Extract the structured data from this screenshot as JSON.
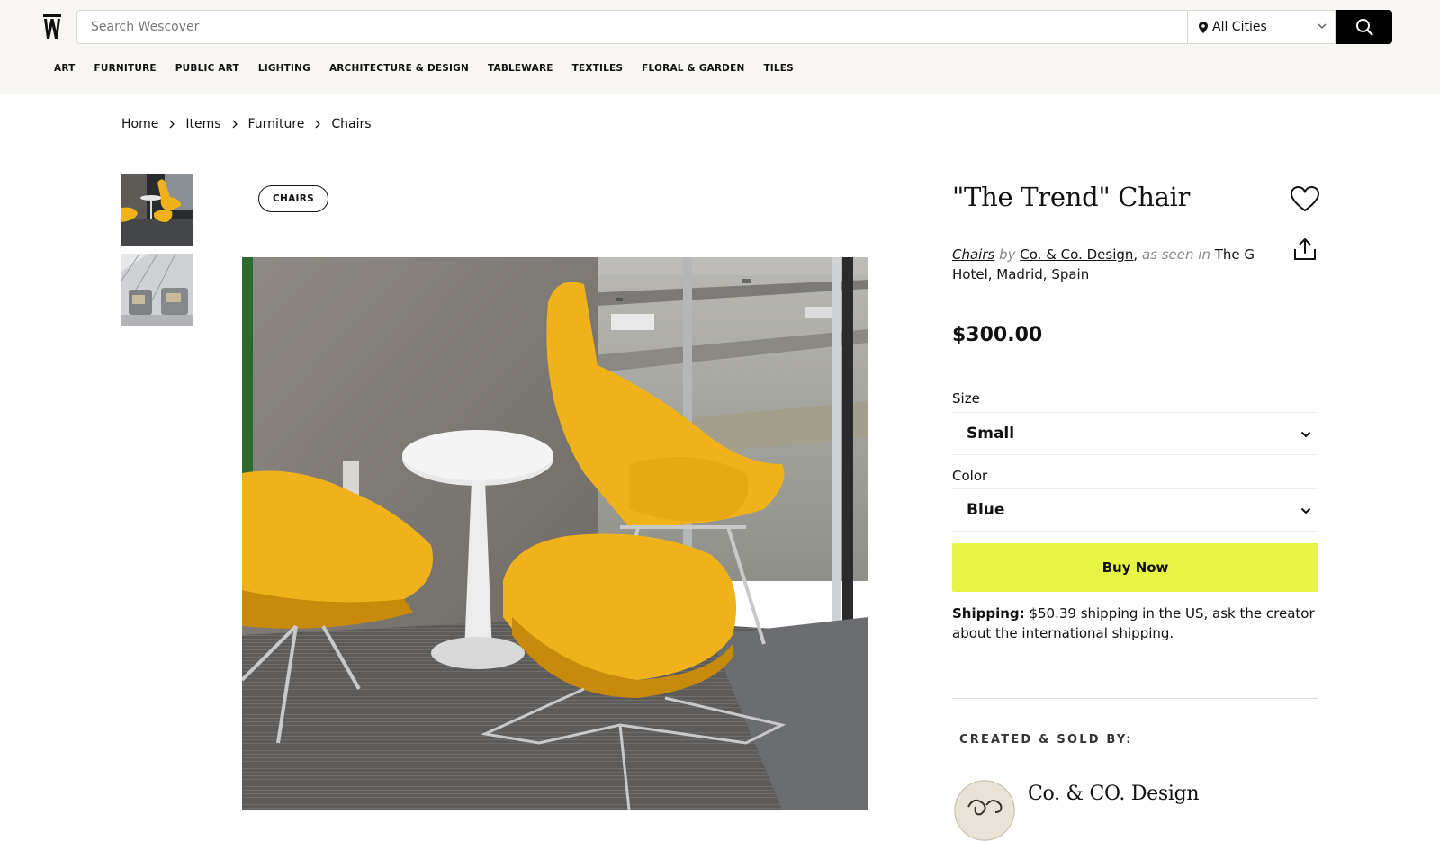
{
  "header": {
    "logo_alt": "W",
    "search": {
      "placeholder": "Search Wescover",
      "value": ""
    },
    "city_select": {
      "value": "All Cities",
      "icon": "map-pin-icon"
    },
    "search_button_icon": "search-icon",
    "nav": [
      "ART",
      "FURNITURE",
      "PUBLIC ART",
      "LIGHTING",
      "ARCHITECTURE & DESIGN",
      "TABLEWARE",
      "TEXTILES",
      "FLORAL & GARDEN",
      "TILES"
    ]
  },
  "breadcrumb": [
    "Home",
    "Items",
    "Furniture",
    "Chairs"
  ],
  "gallery": {
    "tag": "CHAIRS",
    "thumbnails": [
      "thumbnail-yellow-chairs",
      "thumbnail-grey-chairs"
    ]
  },
  "product": {
    "title": "\"The Trend\" Chair",
    "category": "Chairs",
    "by_text": "by",
    "maker": "Co. & Co. Design",
    "comma": ",",
    "seen_text": "as seen in",
    "location": "The G Hotel, Madrid, Spain",
    "price": "$300.00",
    "size_label": "Size",
    "size_value": "Small",
    "color_label": "Color",
    "color_value": "Blue",
    "buy_label": "Buy Now",
    "shipping_label": "Shipping:",
    "shipping_text": "$50.39 shipping in the US, ask the creator about the international shipping."
  },
  "seller": {
    "label": "CREATED & SOLD BY:",
    "name": "Co. & CO. Design"
  },
  "colors": {
    "header_bg": "#f8f6f3",
    "buy_button": "#e6f543",
    "chair_yellow": "#f0b21b"
  }
}
